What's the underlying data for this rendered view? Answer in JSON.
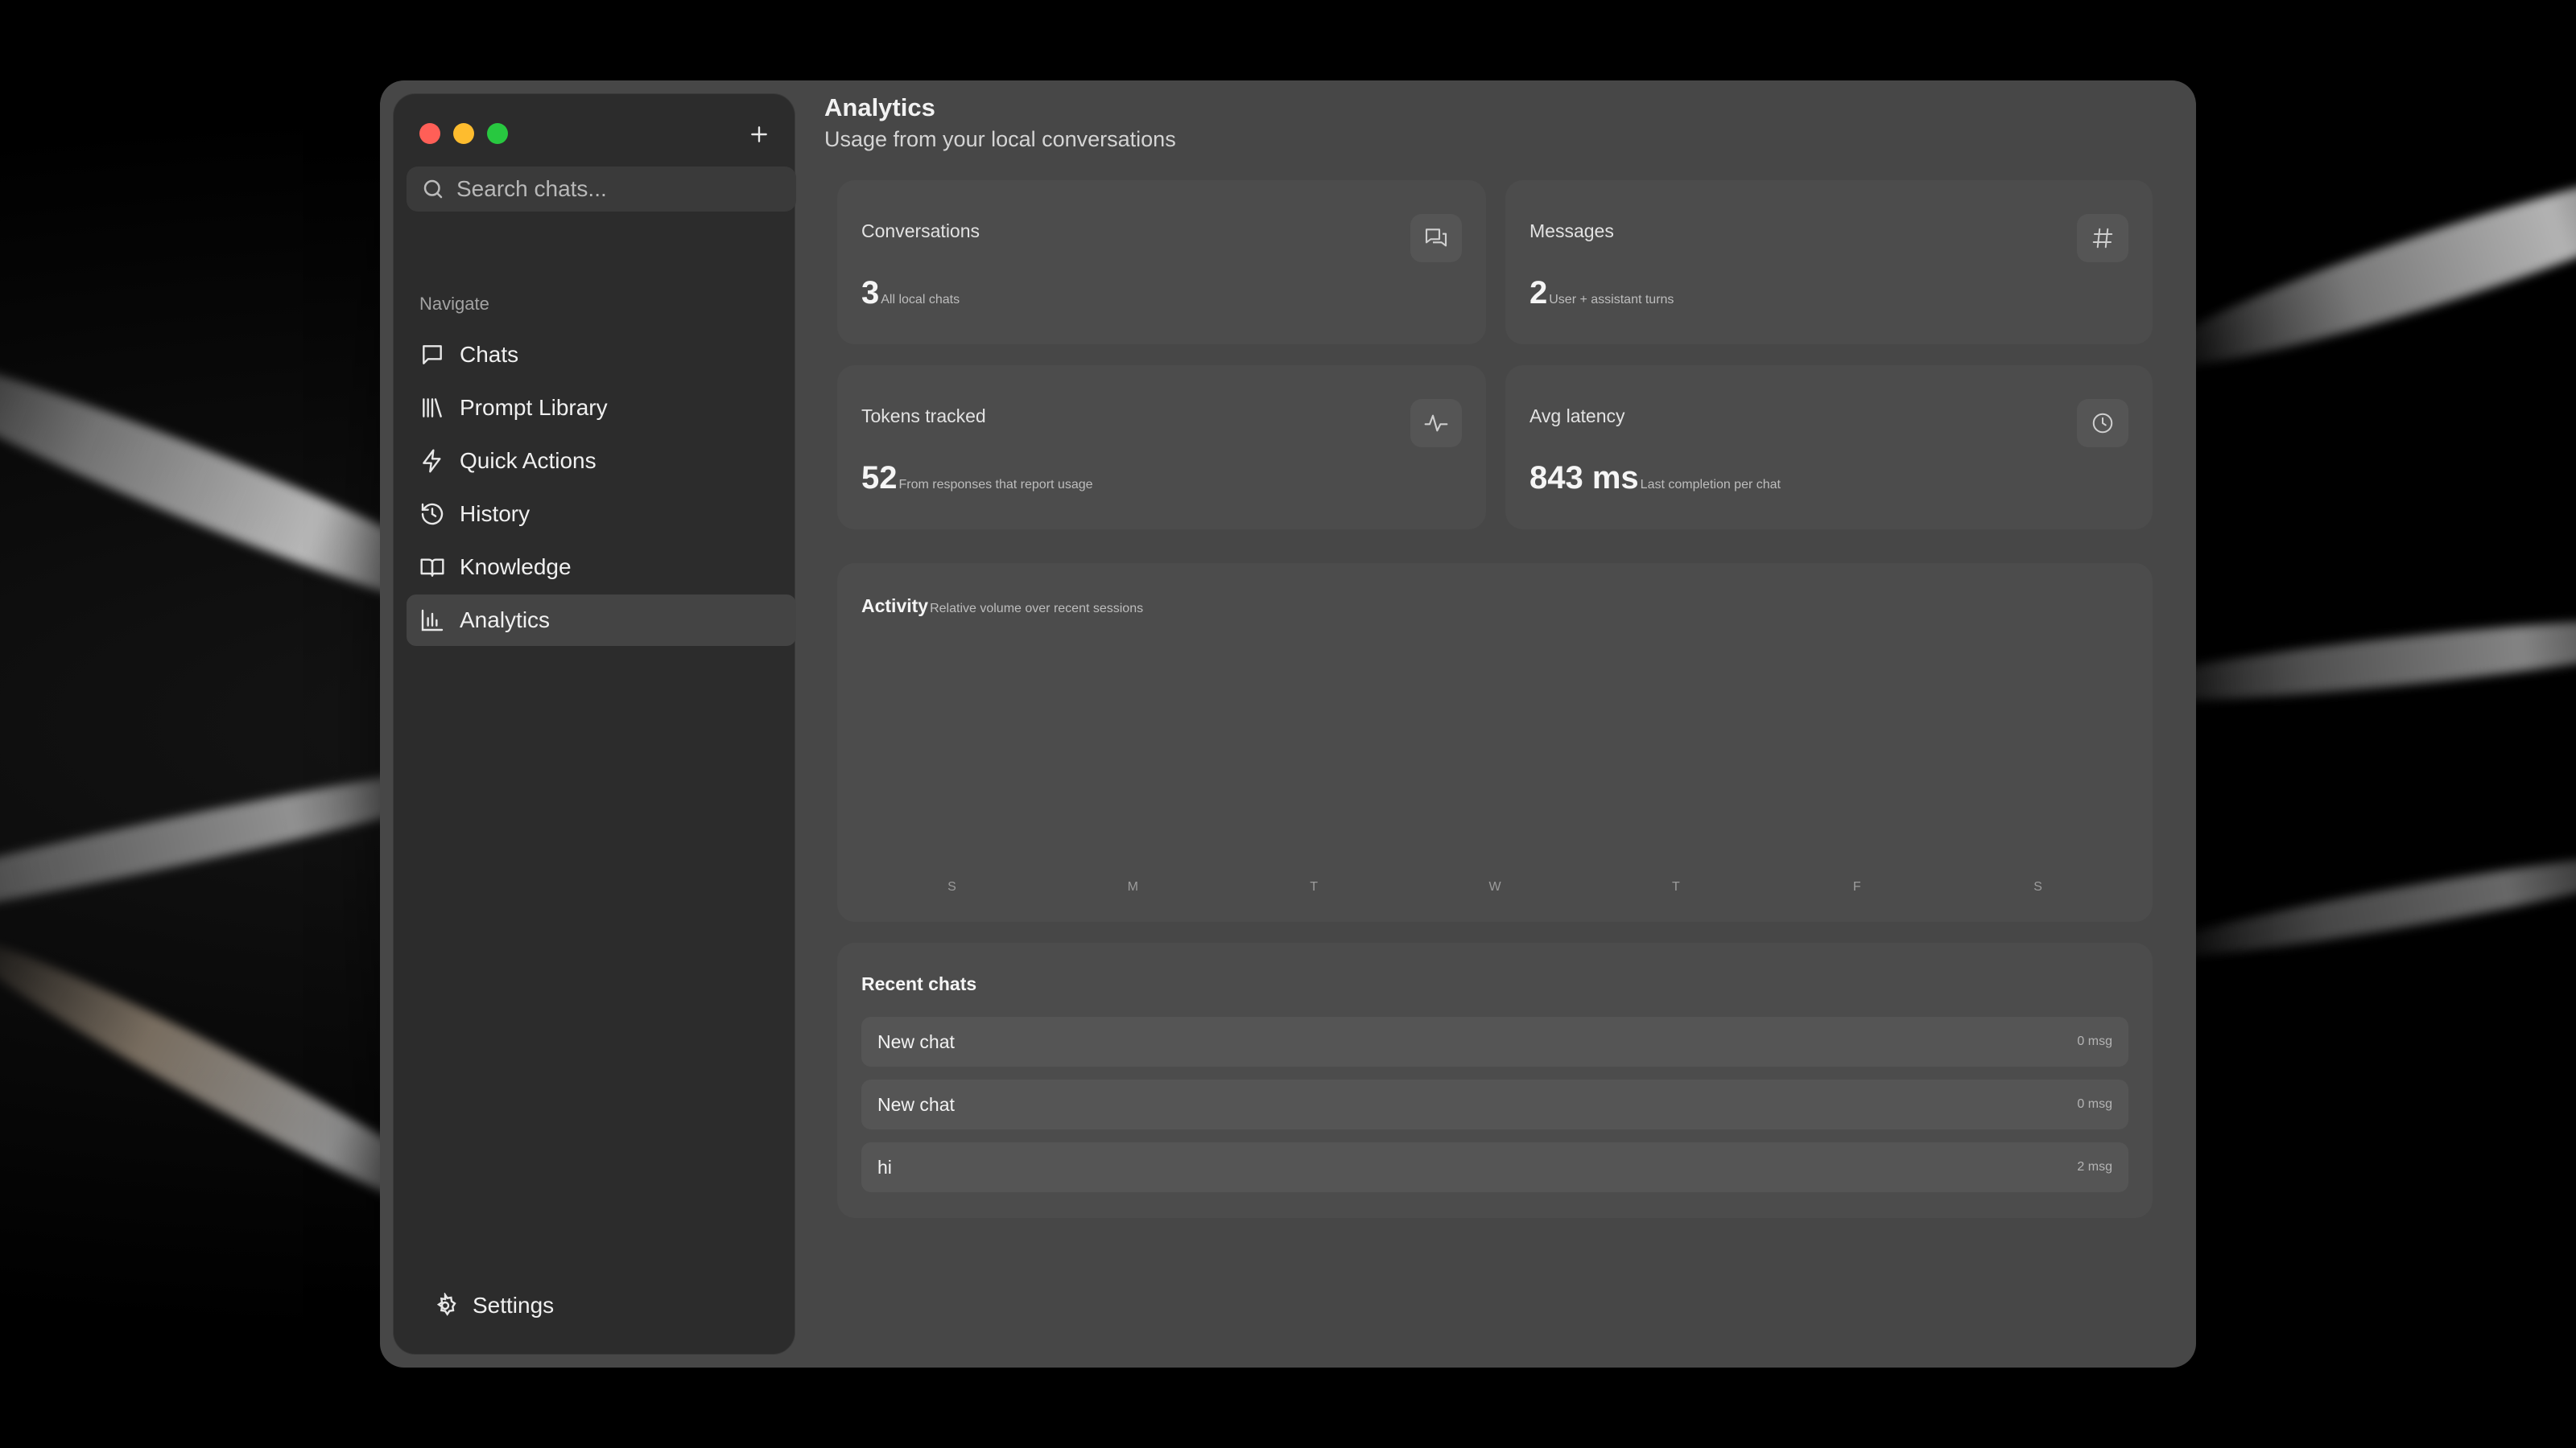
{
  "sidebar": {
    "search_placeholder": "Search chats...",
    "section_label": "Navigate",
    "items": [
      {
        "label": "Chats",
        "icon": "chat-bubble-icon"
      },
      {
        "label": "Prompt Library",
        "icon": "library-icon"
      },
      {
        "label": "Quick Actions",
        "icon": "lightning-icon"
      },
      {
        "label": "History",
        "icon": "history-icon"
      },
      {
        "label": "Knowledge",
        "icon": "book-icon"
      },
      {
        "label": "Analytics",
        "icon": "bar-chart-icon",
        "active": true
      }
    ],
    "settings_label": "Settings"
  },
  "header": {
    "title": "Analytics",
    "subtitle": "Usage from your local conversations"
  },
  "stats": {
    "conversations": {
      "label": "Conversations",
      "value": "3",
      "note": "All local chats",
      "icon": "chats-icon"
    },
    "messages": {
      "label": "Messages",
      "value": "2",
      "note": "User + assistant turns",
      "icon": "hash-icon"
    },
    "tokens": {
      "label": "Tokens tracked",
      "value": "52",
      "note": "From responses that report usage",
      "icon": "pulse-icon"
    },
    "latency": {
      "label": "Avg latency",
      "value": "843 ms",
      "note": "Last completion per chat",
      "icon": "clock-icon"
    }
  },
  "activity": {
    "title": "Activity",
    "subtitle": "Relative volume over recent sessions",
    "days": [
      "S",
      "M",
      "T",
      "W",
      "T",
      "F",
      "S"
    ]
  },
  "recent": {
    "title": "Recent chats",
    "rows": [
      {
        "name": "New chat",
        "count": "0 msg"
      },
      {
        "name": "New chat",
        "count": "0 msg"
      },
      {
        "name": "hi",
        "count": "2 msg"
      }
    ]
  },
  "colors": {
    "window_bg": "#474747",
    "sidebar_bg": "#2c2c2c",
    "card_bg": "#4c4c4c",
    "close": "#ff5f57",
    "minimize": "#febc2e",
    "maximize": "#28c840"
  }
}
